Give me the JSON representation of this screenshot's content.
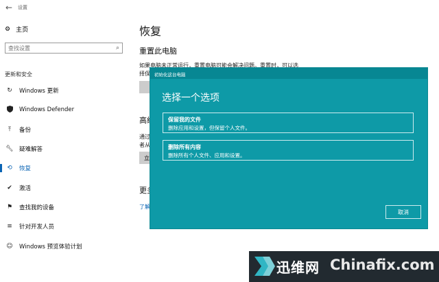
{
  "window": {
    "title": "设置",
    "back_icon": "back-arrow-icon"
  },
  "sidebar": {
    "home_label": "主页",
    "search_placeholder": "查找设置",
    "section_heading": "更新和安全",
    "items": [
      {
        "label": "Windows 更新",
        "icon": "refresh-icon"
      },
      {
        "label": "Windows Defender",
        "icon": "shield-icon"
      },
      {
        "label": "备份",
        "icon": "backup-arrow-icon"
      },
      {
        "label": "疑难解答",
        "icon": "wrench-icon"
      },
      {
        "label": "恢复",
        "icon": "history-icon",
        "active": true
      },
      {
        "label": "激活",
        "icon": "check-circle-icon"
      },
      {
        "label": "查找我的设备",
        "icon": "person-locate-icon"
      },
      {
        "label": "针对开发人员",
        "icon": "developer-icon"
      },
      {
        "label": "Windows 预览体验计划",
        "icon": "insider-icon"
      }
    ]
  },
  "main": {
    "title": "恢复",
    "reset_title": "重置此电脑",
    "reset_desc_line1": "如果电脑未正常运行，重置电脑可能会解决问题。重置时，可以选",
    "reset_desc_line2": "择保",
    "advanced_title": "高级",
    "advanced_desc_line1": "通过",
    "advanced_desc_line2": "者从",
    "advanced_button": "立",
    "more_title": "更多",
    "more_link": "了解"
  },
  "dialog": {
    "header": "初始化这台电脑",
    "title": "选择一个选项",
    "options": [
      {
        "title": "保留我的文件",
        "desc": "删除应用和设置，但保留个人文件。"
      },
      {
        "title": "删除所有内容",
        "desc": "删除所有个人文件、应用和设置。"
      }
    ],
    "cancel_label": "取消"
  },
  "watermark": {
    "cn": "迅维网",
    "en": "Chinafix.com"
  },
  "colors": {
    "accent": "#0a64b4",
    "dialog_bg": "#0e9aa7",
    "dialog_header": "#078793"
  }
}
